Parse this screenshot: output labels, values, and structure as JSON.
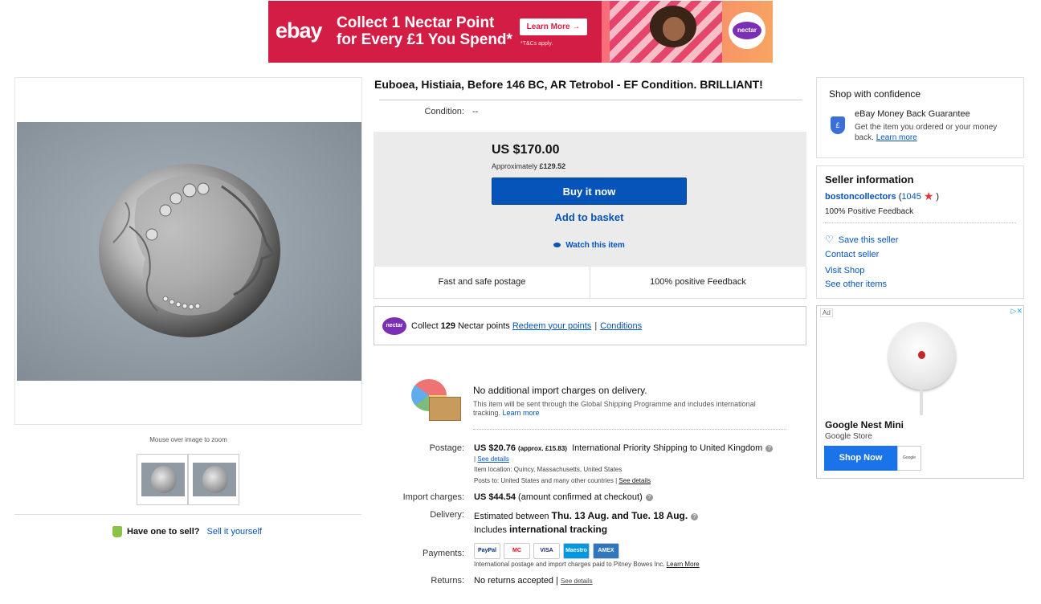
{
  "banner": {
    "logo": "ebay",
    "headline_line1": "Collect 1 Nectar Point",
    "headline_line2": "for Every £1 You Spend*",
    "cta": "Learn More →",
    "tcs": "*T&Cs apply.",
    "nectar_logo": "nectar"
  },
  "gallery": {
    "zoom_hint": "Mouse over image to zoom",
    "thumb_count": 2
  },
  "sell": {
    "question": "Have one to sell?",
    "link": "Sell it yourself"
  },
  "item": {
    "title": "Euboea, Histiaia, Before 146 BC, AR Tetrobol - EF Condition. BRILLIANT!",
    "condition_label": "Condition:",
    "condition_value": "--",
    "price": "US $170.00",
    "approx_label": "Approximately",
    "approx_value": "£129.52",
    "buy_now": "Buy it now",
    "add_to_basket": "Add to basket",
    "watch": "Watch this item",
    "feature_1": "Fast and safe postage",
    "feature_2": "100% positive Feedback"
  },
  "nectar": {
    "logo": "nectar",
    "prefix": "Collect",
    "points": "129",
    "suffix": "Nectar points",
    "redeem": "Redeem your points",
    "separator": "|",
    "conditions": "Conditions"
  },
  "shipping": {
    "gsp_title": "No additional import charges on delivery.",
    "gsp_desc": "This item will be sent through the Global Shipping Programme and includes international tracking.",
    "gsp_learn": "Learn more",
    "postage_label": "Postage:",
    "postage_price": "US $20.76",
    "postage_approx": "(approx. £15.83)",
    "postage_service": "International Priority Shipping to United Kingdom",
    "see_details": "See details",
    "item_location": "Item location:  Quincy, Massachusetts, United States",
    "posts_to": "Posts to:  United States and many other countries |",
    "import_label": "Import charges:",
    "import_value": "US $44.54",
    "import_note": "(amount confirmed at checkout)",
    "delivery_label": "Delivery:",
    "delivery_prefix": "Estimated between",
    "delivery_dates": "Thu. 13 Aug. and Tue. 18 Aug.",
    "delivery_includes": "Includes",
    "delivery_tracking": "international tracking",
    "payments_label": "Payments:",
    "payment_methods": [
      "PayPal",
      "MC",
      "VISA",
      "Maestro",
      "AMEX"
    ],
    "payments_note": "International postage and import charges paid to Pitney Bowes Inc.",
    "payments_learn": "Learn More",
    "returns_label": "Returns:",
    "returns_value": "No returns accepted |"
  },
  "confidence": {
    "title": "Shop with confidence",
    "shield": "£",
    "guarantee": "eBay Money Back Guarantee",
    "desc": "Get the item you ordered or your money back.",
    "learn": "Learn more"
  },
  "seller": {
    "title": "Seller information",
    "name": "bostoncollectors",
    "open_paren": "(",
    "feedback_count": "1045",
    "close_paren": ")",
    "positive": "100% Positive Feedback",
    "save": "Save this seller",
    "contact": "Contact seller",
    "visit": "Visit Shop",
    "other": "See other items"
  },
  "ad": {
    "label": "Ad",
    "choices": "▷✕",
    "product": "Google Nest Mini",
    "store": "Google Store",
    "cta": "Shop Now",
    "cta_logo": "Google Store"
  }
}
